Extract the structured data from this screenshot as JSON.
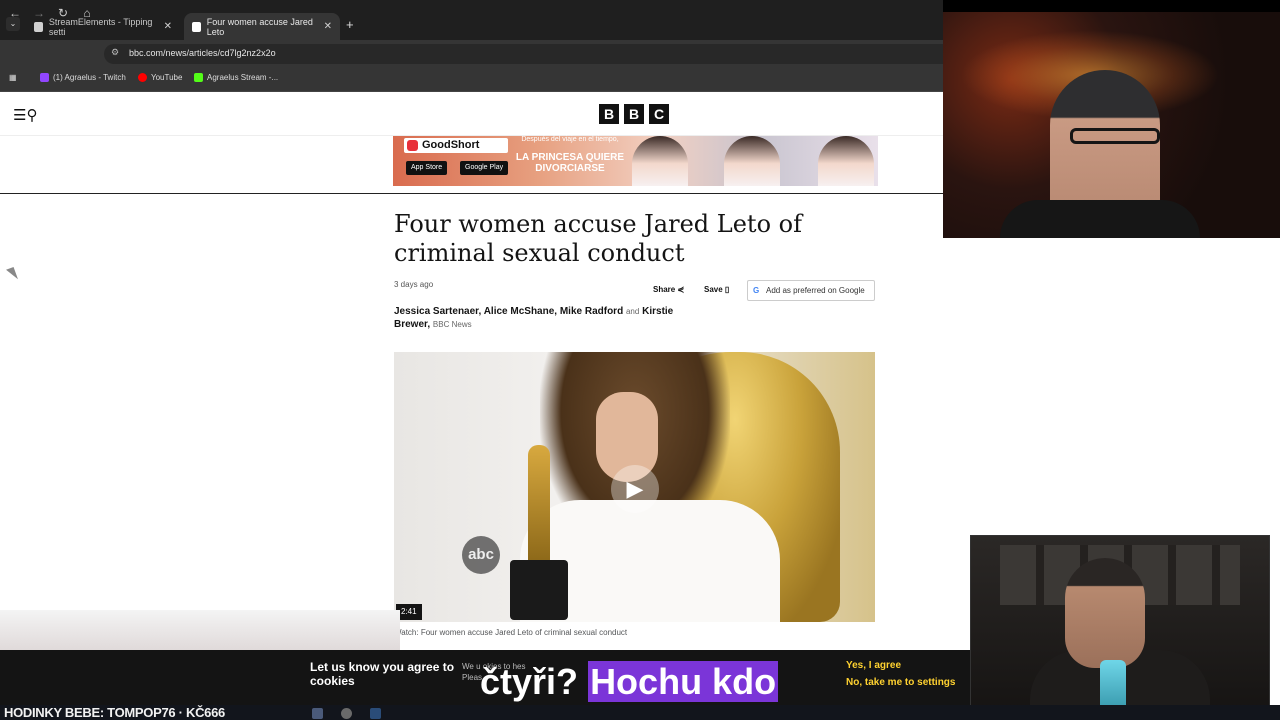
{
  "browser": {
    "tabs": [
      {
        "title": "StreamElements - Tipping setti",
        "active": false
      },
      {
        "title": "Four women accuse Jared Leto",
        "active": true
      }
    ],
    "url": "bbc.com/news/articles/cd7lg2nz2x2o",
    "bookmarks": [
      "(1) Agraelus - Twitch",
      "YouTube",
      "Agraelus Stream -..."
    ]
  },
  "bbc": {
    "logo_letters": [
      "B",
      "B",
      "C"
    ],
    "ad": {
      "brand": "GoodShort",
      "tagline": "Después del viaje en el tiempo,",
      "title": "LA PRINCESA QUIERE DIVORCIARSE",
      "appstore": "App Store",
      "googleplay": "Google Play"
    },
    "article": {
      "headline": "Four women accuse Jared Leto of criminal sexual conduct",
      "timestamp": "3 days ago",
      "share": "Share",
      "save": "Save",
      "google_pref": "Add as preferred on Google",
      "authors": "Jessica Sartenaer, Alice McShane, Mike Radford",
      "and": "and",
      "authors_last": "Kirstie Brewer,",
      "source": "BBC News",
      "video_duration": "2:41",
      "video_logo": "abc",
      "video_caption": "Watch: Four women accuse Jared Leto of criminal sexual conduct"
    },
    "cookie": {
      "title": "Let us know you agree to cookies",
      "text_fragment_1": "We u",
      "text_fragment_2": "okies to",
      "text_fragment_3": "hes",
      "text_fragment_4": "Pleas",
      "agree": "Yes, I agree",
      "settings": "No, take me to settings"
    }
  },
  "overlay": {
    "subtitle_plain": "čtyři?",
    "subtitle_highlight": "Hochu kdo",
    "ticker": "HODINKY BEBE: TOMPOP76 · KČ666"
  },
  "colors": {
    "chrome_dark": "#1f1f1f",
    "bbc_black": "#111111",
    "cookie_accent": "#ffd230",
    "subtitle_highlight": "#7b35d8"
  }
}
